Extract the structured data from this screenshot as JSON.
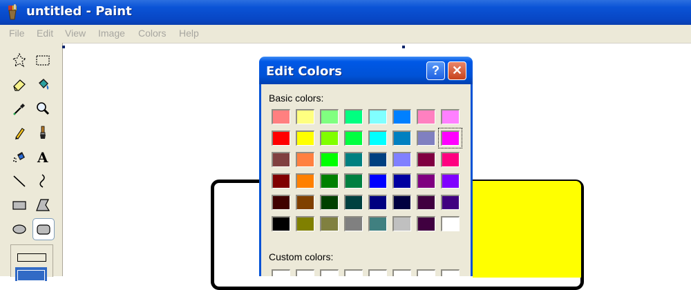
{
  "window": {
    "title": "untitled - Paint",
    "icon": "paint-app-icon"
  },
  "menubar": {
    "items": [
      "File",
      "Edit",
      "View",
      "Image",
      "Colors",
      "Help"
    ]
  },
  "toolbox": {
    "tools": [
      "free-form-select-icon",
      "select-icon",
      "eraser-icon",
      "fill-bucket-icon",
      "pick-color-icon",
      "magnifier-icon",
      "pencil-icon",
      "brush-icon",
      "airbrush-icon",
      "text-icon",
      "line-icon",
      "curve-icon",
      "rectangle-icon",
      "polygon-icon",
      "ellipse-icon",
      "rounded-rectangle-icon"
    ],
    "selected_tool": "rounded-rectangle-icon"
  },
  "dialog": {
    "title": "Edit Colors",
    "help_label": "?",
    "close_label": "✕",
    "basic_colors_label": "Basic colors:",
    "custom_colors_label": "Custom colors:",
    "basic_colors": [
      [
        "#ff8080",
        "#ffff80",
        "#80ff80",
        "#00ff80",
        "#80ffff",
        "#0080ff",
        "#ff80c0",
        "#ff80ff"
      ],
      [
        "#ff0000",
        "#ffff00",
        "#80ff00",
        "#00ff40",
        "#00ffff",
        "#0080c0",
        "#8080c0",
        "#ff00ff"
      ],
      [
        "#804040",
        "#ff8040",
        "#00ff00",
        "#008080",
        "#004080",
        "#8080ff",
        "#800040",
        "#ff0080"
      ],
      [
        "#800000",
        "#ff8000",
        "#008000",
        "#008040",
        "#0000ff",
        "#0000a0",
        "#800080",
        "#8000ff"
      ],
      [
        "#400000",
        "#804000",
        "#004000",
        "#004040",
        "#000080",
        "#000040",
        "#400040",
        "#400080"
      ],
      [
        "#000000",
        "#808000",
        "#808040",
        "#808080",
        "#408080",
        "#c0c0c0",
        "#400040",
        "#ffffff"
      ]
    ],
    "selected_color": "#ff00ff"
  },
  "canvas": {
    "background": "#ffffff",
    "shape_fill": "#ffff00",
    "shape_outline": "#000000"
  }
}
